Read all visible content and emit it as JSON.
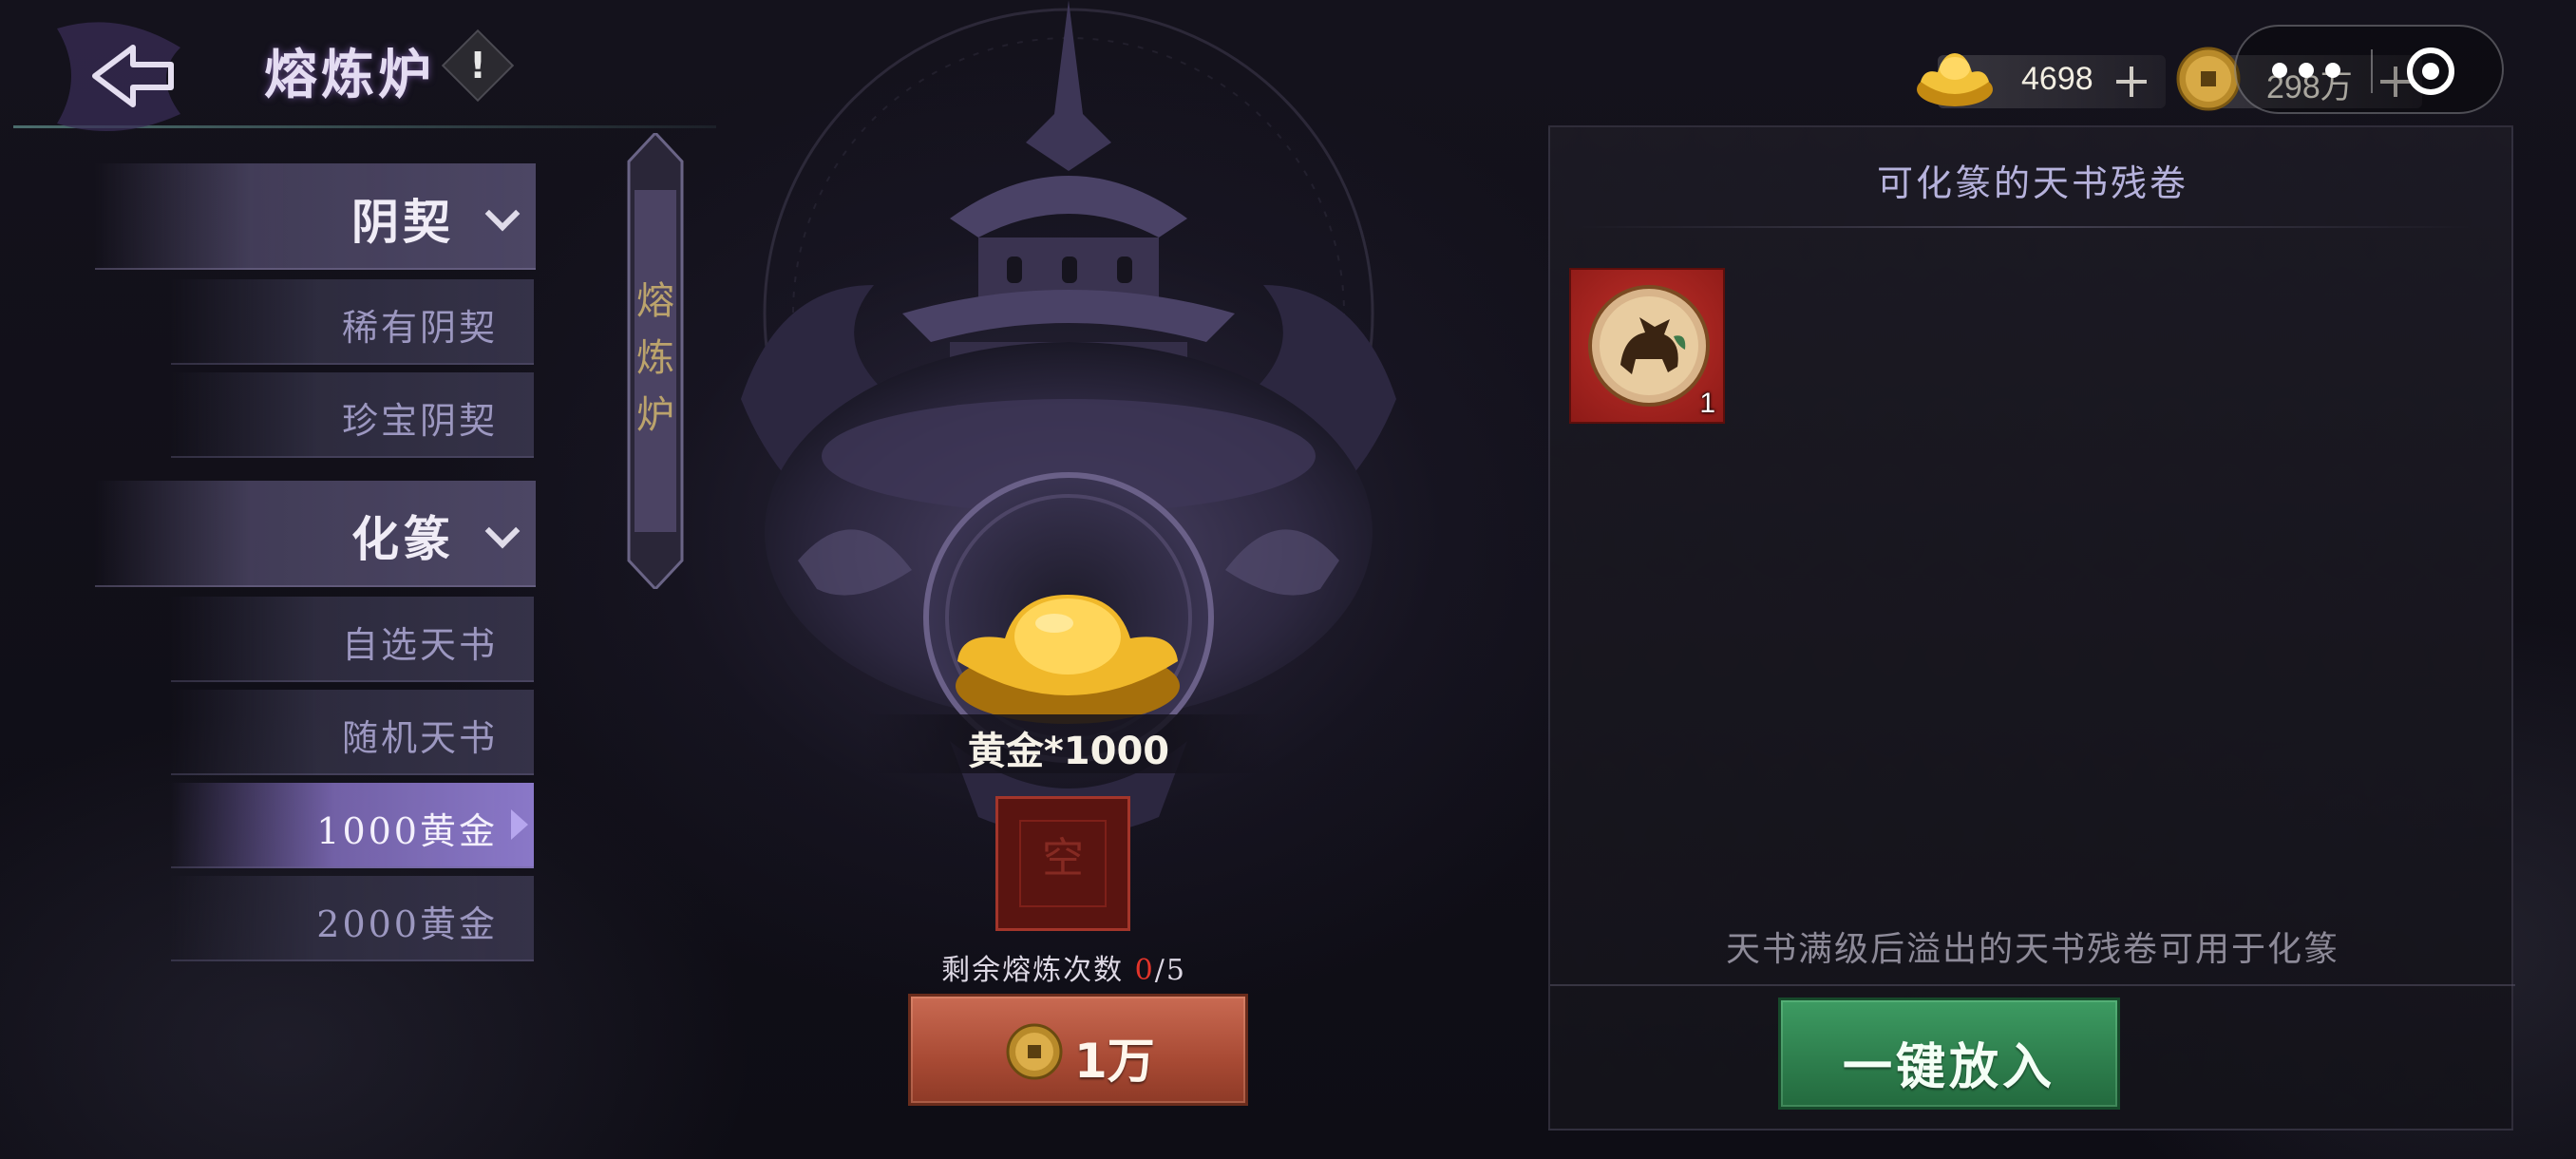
{
  "header": {
    "title": "熔炼炉",
    "info_label": "!"
  },
  "currency": {
    "gold_ingot": {
      "value": "4698",
      "icon": "gold-ingot-icon"
    },
    "copper_coin": {
      "value": "298万",
      "icon": "copper-coin-icon"
    }
  },
  "sidebar": {
    "categories": [
      {
        "label": "阴契",
        "items": [
          "稀有阴契",
          "珍宝阴契"
        ]
      },
      {
        "label": "化篆",
        "items": [
          "自选天书",
          "随机天书",
          "1000黄金",
          "2000黄金"
        ]
      }
    ],
    "active_item": "1000黄金"
  },
  "banner": {
    "text": [
      "熔",
      "炼",
      "炉"
    ]
  },
  "furnace": {
    "reward_label": "黄金*1000",
    "slot_placeholder": "空",
    "remaining_prefix": "剩余熔炼次数",
    "remaining_used": "0",
    "remaining_total": "/5",
    "cost_label": "1万"
  },
  "panel": {
    "title": "可化篆的天书残卷",
    "items": [
      {
        "name": "bull-emblem-scroll",
        "count": "1"
      }
    ],
    "note": "天书满级后溢出的天书残卷可用于化篆",
    "one_key_label": "一键放入"
  },
  "colors": {
    "accent_purple": "#8a78c8",
    "cost_button": "#a84a34",
    "confirm_button": "#2d7d4c",
    "highlight_red": "#e2342a"
  }
}
